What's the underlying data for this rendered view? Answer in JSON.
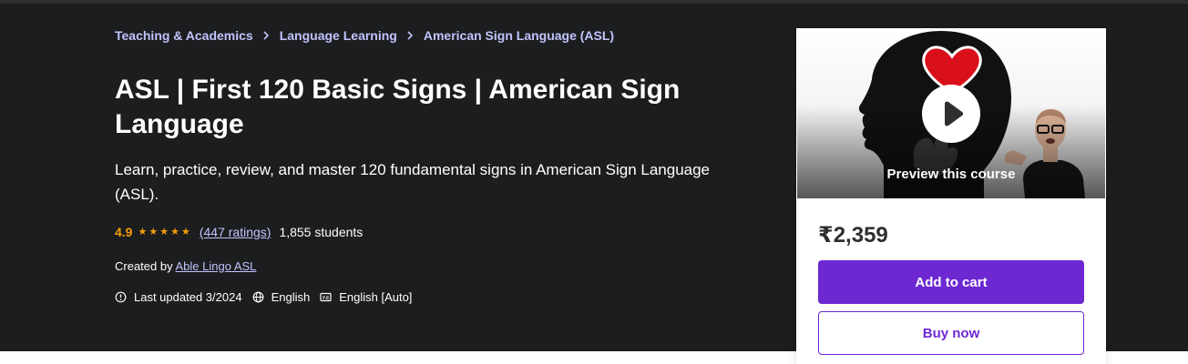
{
  "breadcrumb": {
    "items": [
      {
        "label": "Teaching & Academics"
      },
      {
        "label": "Language Learning"
      },
      {
        "label": "American Sign Language (ASL)"
      }
    ]
  },
  "course": {
    "title": "ASL | First 120 Basic Signs | American Sign Language",
    "subtitle": "Learn, practice, review, and master 120 fundamental signs in American Sign Language (ASL).",
    "rating": "4.9",
    "stars": 4.9,
    "ratings_count": "(447 ratings)",
    "students": "1,855 students",
    "created_by_label": "Created by",
    "author": "Able Lingo ASL",
    "last_updated": "Last updated 3/2024",
    "language": "English",
    "captions": "English [Auto]"
  },
  "sidebar": {
    "preview_label": "Preview this course",
    "price": "₹2,359",
    "add_to_cart": "Add to cart",
    "buy_now": "Buy now"
  },
  "colors": {
    "hero_bg": "#1c1d1f",
    "accent": "#6d28d2",
    "link": "#c0c4fc",
    "star": "#f69c08"
  },
  "icons": {
    "breadcrumb_separator": "chevron-right-icon",
    "star": "star-icon",
    "updated": "alert-clock-icon",
    "language": "globe-icon",
    "captions": "closed-captions-icon",
    "play": "play-icon"
  }
}
